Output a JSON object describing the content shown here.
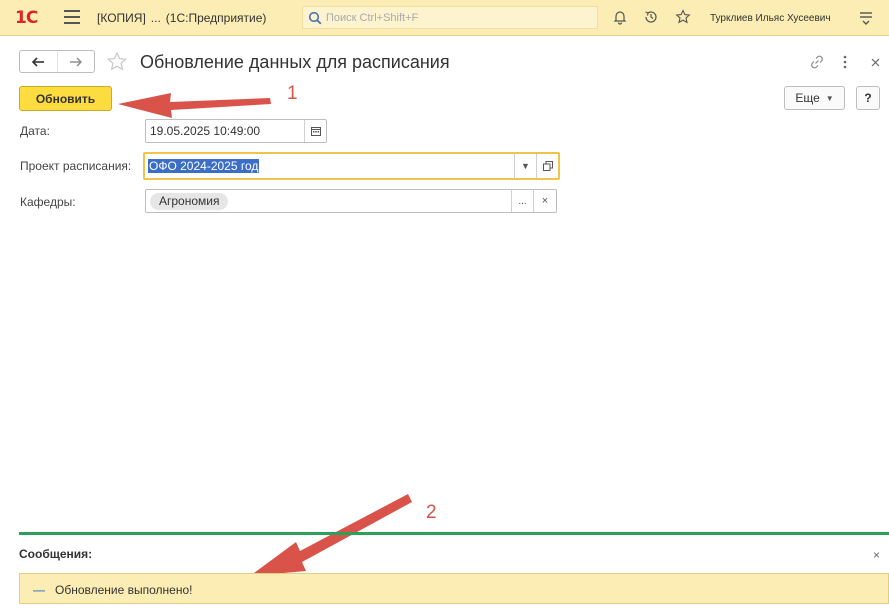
{
  "topbar": {
    "logo_text": "1C",
    "title_copy": "[КОПИЯ]",
    "title_ellipsis": "...",
    "title_app": "(1С:Предприятие)",
    "search_placeholder": "Поиск Ctrl+Shift+F",
    "user_name": "Турклиев Ильяс Хусеевич",
    "brand_color": "#d8262a",
    "bar_color": "#fbedb3"
  },
  "form": {
    "title": "Обновление данных для расписания",
    "icons": [
      "back-arrow-icon",
      "forward-arrow-icon",
      "star-icon",
      "link-icon",
      "more-vertical-icon",
      "close-icon"
    ]
  },
  "commandbar": {
    "update_label": "Обновить",
    "more_label": "Еще",
    "help_label": "?"
  },
  "fields": {
    "date": {
      "label": "Дата:",
      "value": "19.05.2025 10:49:00"
    },
    "project": {
      "label": "Проект расписания:",
      "value": "ОФО 2024-2025 год"
    },
    "departments": {
      "label": "Кафедры:",
      "value": "Агрономия",
      "select_label": "...",
      "clear_label": "×"
    }
  },
  "annotations": {
    "one": "1",
    "two": "2",
    "arrow_color": "#d9534a"
  },
  "messages": {
    "title": "Сообщения:",
    "close_label": "×",
    "items": [
      {
        "text": "Обновление выполнено!"
      }
    ],
    "accent_color": "#2ca058"
  }
}
